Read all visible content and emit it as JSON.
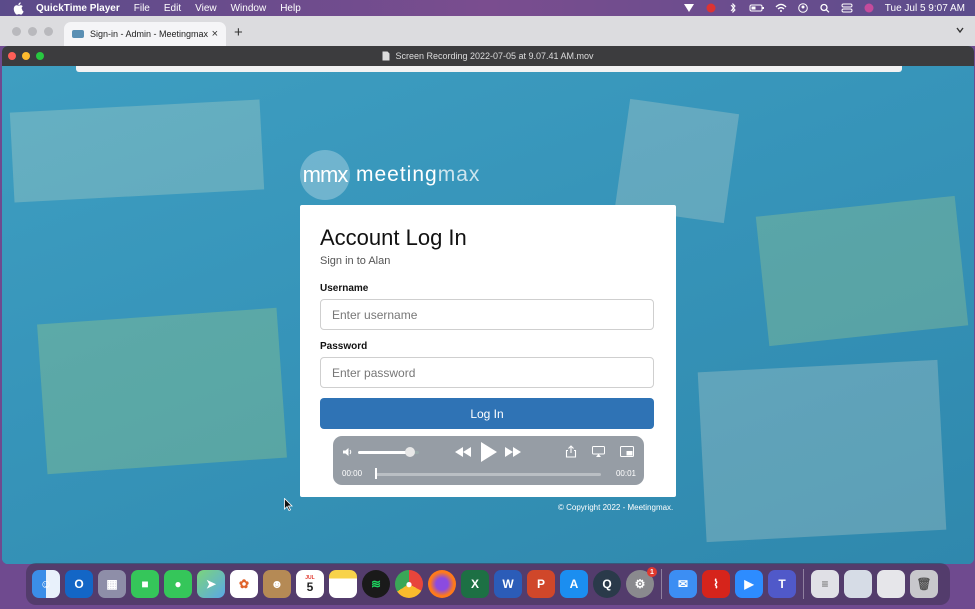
{
  "menubar": {
    "app_name": "QuickTime Player",
    "menus": [
      "File",
      "Edit",
      "View",
      "Window",
      "Help"
    ],
    "clock": "Tue Jul 5  9:07 AM"
  },
  "browser": {
    "tab_title": "Sign-in - Admin - Meetingmax",
    "new_tab": "+"
  },
  "quicktime": {
    "window_title": "Screen Recording 2022-07-05 at 9.07.41 AM.mov",
    "volume_level": 0.85,
    "time_current": "00:00",
    "time_end": "00:01",
    "progress": 0.0
  },
  "page": {
    "logo_mark": "mmx",
    "logo_word_1": "meeting",
    "logo_word_2": "max",
    "heading": "Account Log In",
    "subheading": "Sign in to Alan",
    "username_label": "Username",
    "username_placeholder": "Enter username",
    "password_label": "Password",
    "password_placeholder": "Enter password",
    "login_button": "Log In",
    "copyright": "© Copyright 2022 - Meetingmax."
  },
  "dock": {
    "calendar_month": "JUL",
    "calendar_day": "5",
    "settings_badge": "1"
  },
  "colors": {
    "video_bg": "#3a99bd",
    "login_button": "#2f73b5"
  }
}
